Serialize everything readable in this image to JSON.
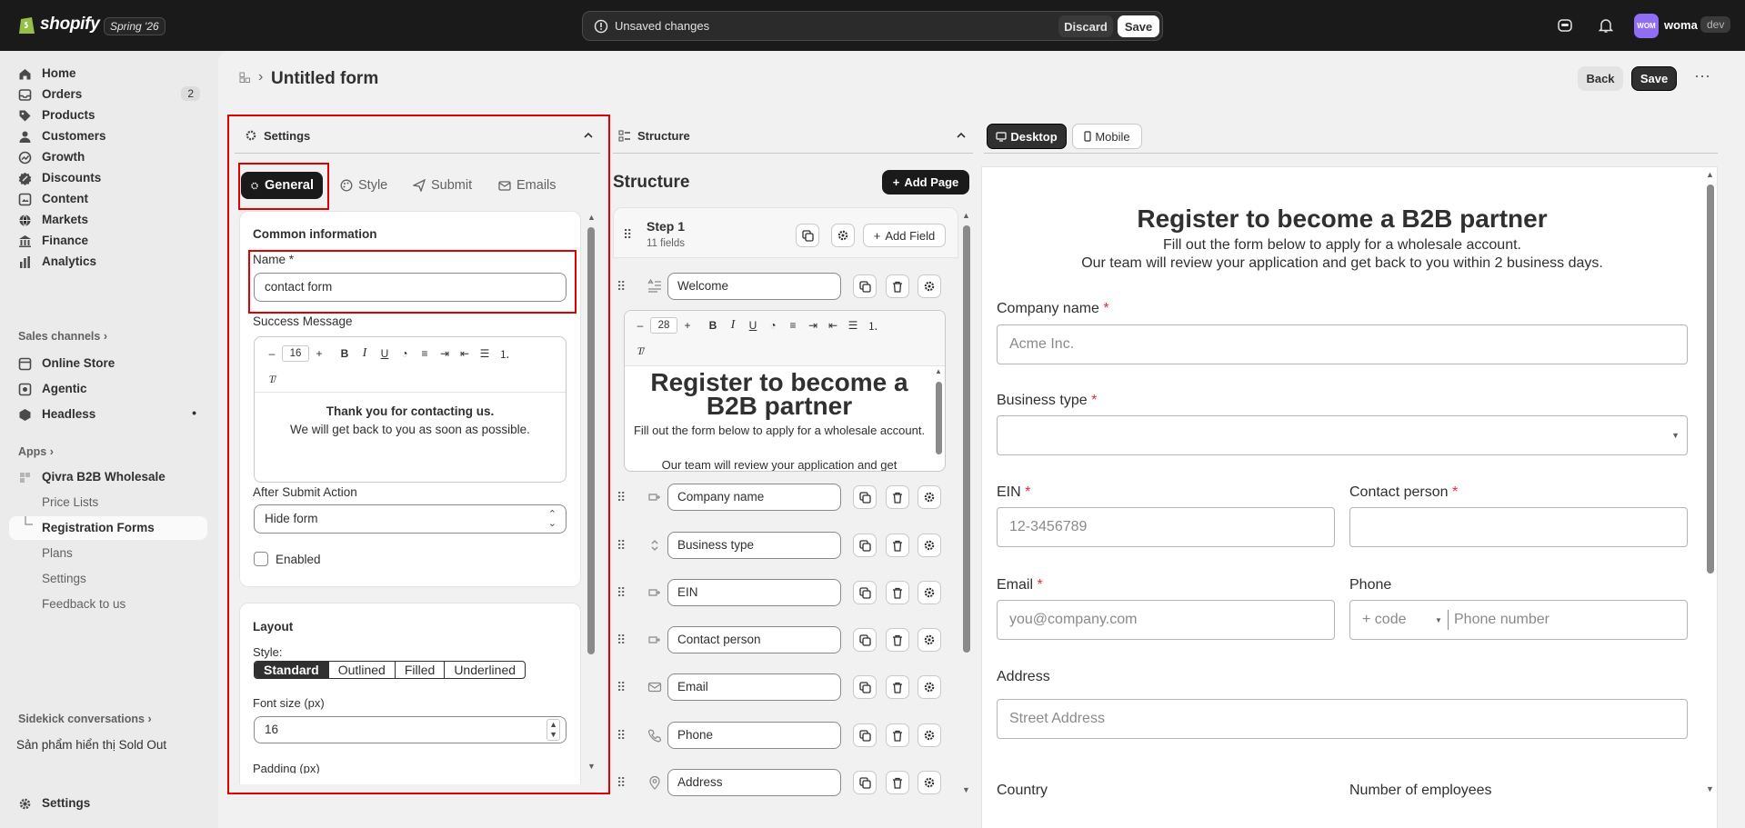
{
  "topbar": {
    "brand": "shopify",
    "edition": "Spring '26",
    "unsaved_text": "Unsaved changes",
    "discard_label": "Discard",
    "save_label": "Save",
    "avatar_initials": "WOM",
    "store_name": "woma",
    "env_badge": "dev"
  },
  "sidebar": {
    "items": [
      {
        "label": "Home",
        "icon": "home-icon"
      },
      {
        "label": "Orders",
        "icon": "orders-icon",
        "badge": "2"
      },
      {
        "label": "Products",
        "icon": "tag-icon"
      },
      {
        "label": "Customers",
        "icon": "person-icon"
      },
      {
        "label": "Growth",
        "icon": "growth-icon"
      },
      {
        "label": "Discounts",
        "icon": "discount-icon"
      },
      {
        "label": "Content",
        "icon": "content-icon"
      },
      {
        "label": "Markets",
        "icon": "globe-icon"
      },
      {
        "label": "Finance",
        "icon": "bank-icon"
      },
      {
        "label": "Analytics",
        "icon": "chart-bar-icon"
      }
    ],
    "sales_channels_label": "Sales channels",
    "channels": [
      {
        "label": "Online Store",
        "icon": "store-icon"
      },
      {
        "label": "Agentic",
        "icon": "agentic-icon"
      },
      {
        "label": "Headless",
        "icon": "headless-icon"
      }
    ],
    "apps_label": "Apps",
    "app_name": "Qivra B2B Wholesale",
    "app_subitems": [
      "Price Lists",
      "Registration Forms",
      "Plans",
      "Settings",
      "Feedback to us"
    ],
    "sidekick_label": "Sidekick conversations",
    "sidekick_item": "Sản phẩm hiển thị Sold Out",
    "settings_label": "Settings"
  },
  "page": {
    "title": "Untitled form",
    "back_label": "Back",
    "save_label": "Save",
    "more_label": "⋯"
  },
  "settings_panel": {
    "header": "Settings",
    "tabs": [
      "General",
      "Style",
      "Submit",
      "Emails"
    ],
    "common_info_title": "Common information",
    "name_label": "Name *",
    "name_value": "contact form",
    "success_label": "Success Message",
    "rte_font_size": "16",
    "success_line1": "Thank you for contacting us.",
    "success_line2": "We will get back to you as soon as possible.",
    "after_submit_label": "After Submit Action",
    "after_submit_value": "Hide form",
    "enabled_label": "Enabled",
    "layout_title": "Layout",
    "style_label": "Style:",
    "style_options": [
      "Standard",
      "Outlined",
      "Filled",
      "Underlined"
    ],
    "style_selected": "Standard",
    "font_size_label": "Font size (px)",
    "font_size_value": "16",
    "padding_label": "Padding (px)"
  },
  "structure_panel": {
    "header": "Structure",
    "title": "Structure",
    "add_page_label": "Add Page",
    "step_title": "Step 1",
    "step_count": "11 fields",
    "add_field_label": "Add Field",
    "rte_font_size": "28",
    "welcome_heading": "Register to become a B2B partner",
    "welcome_line1": "Fill out the form below to apply for a wholesale account.",
    "welcome_line2": "Our team will review your application and get",
    "fields": [
      {
        "label": "Welcome",
        "icon": "text-block-icon"
      },
      {
        "label": "Company name",
        "icon": "text-field-icon"
      },
      {
        "label": "Business type",
        "icon": "select-icon"
      },
      {
        "label": "EIN",
        "icon": "text-field-icon"
      },
      {
        "label": "Contact person",
        "icon": "text-field-icon"
      },
      {
        "label": "Email",
        "icon": "email-icon"
      },
      {
        "label": "Phone",
        "icon": "phone-icon"
      },
      {
        "label": "Address",
        "icon": "location-icon"
      }
    ]
  },
  "preview": {
    "desktop_label": "Desktop",
    "mobile_label": "Mobile",
    "heading": "Register to become a B2B partner",
    "sub1": "Fill out the form below to apply for a wholesale account.",
    "sub2": "Our team will review your application and get back to you within 2 business days.",
    "company_label": "Company name",
    "company_placeholder": "Acme Inc.",
    "business_label": "Business type",
    "ein_label": "EIN",
    "ein_placeholder": "12-3456789",
    "contact_label": "Contact person",
    "email_label": "Email",
    "email_placeholder": "you@company.com",
    "phone_label": "Phone",
    "phone_code_placeholder": "+ code",
    "phone_placeholder": "Phone number",
    "address_label": "Address",
    "address_placeholder": "Street Address",
    "country_label": "Country",
    "employees_label": "Number of employees",
    "required_mark": "*"
  },
  "colors": {
    "accent_red": "#e00000",
    "required": "#e22c38",
    "topbar": "#1a1a1a"
  }
}
